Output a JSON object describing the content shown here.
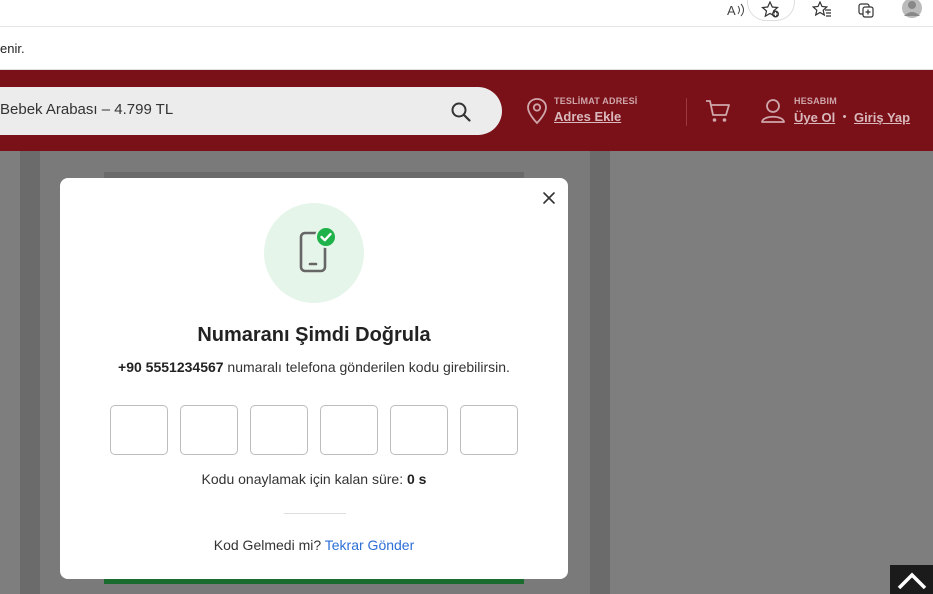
{
  "notice": {
    "text": "enir."
  },
  "search": {
    "query": "Bebek Arabası – 4.799 TL"
  },
  "header": {
    "delivery_label": "TESLİMAT ADRESİ",
    "delivery_link": "Adres Ekle",
    "account_label": "HESABIM",
    "register_link": "Üye Ol",
    "login_link": "Giriş Yap",
    "link_separator": "•"
  },
  "modal": {
    "title": "Numaranı Şimdi Doğrula",
    "phone": "+90 5551234567",
    "subtitle_rest": " numaralı telefona gönderilen kodu girebilirsin.",
    "code_length": 6,
    "timer_label": "Kodu onaylamak için kalan süre: ",
    "timer_value": "0 s",
    "resend_question": "Kod Gelmedi mi? ",
    "resend_link": "Tekrar Gönder"
  },
  "colors": {
    "brand": "#7a1119",
    "success": "#1fb24a",
    "link": "#2d6fd6"
  }
}
